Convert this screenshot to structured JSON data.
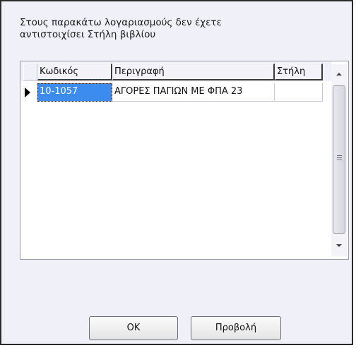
{
  "dialog": {
    "message_line1": "Στους παρακάτω λογαριασμούς δεν έχετε",
    "message_line2": "αντιστοιχίσει Στήλη βιβλίου"
  },
  "grid": {
    "columns": [
      {
        "label": "Κωδικός"
      },
      {
        "label": "Περιγραφή"
      },
      {
        "label": "Στήλη"
      }
    ],
    "rows": [
      {
        "code": "10-1057",
        "description": "ΑΓΟΡΕΣ ΠΑΓΙΩΝ ΜΕ ΦΠΑ 23",
        "column": "",
        "selected": true
      }
    ]
  },
  "buttons": {
    "ok_label": "OK",
    "view_label": "Προβολή"
  },
  "colors": {
    "dialog_background": "#f0f0f8",
    "selection": "#3c8cf0"
  },
  "icons": {
    "row_indicator": "current-row-arrow-icon",
    "scroll_up": "arrow-up-icon",
    "scroll_down": "arrow-down-icon",
    "thumb_grip": "grip-icon"
  }
}
